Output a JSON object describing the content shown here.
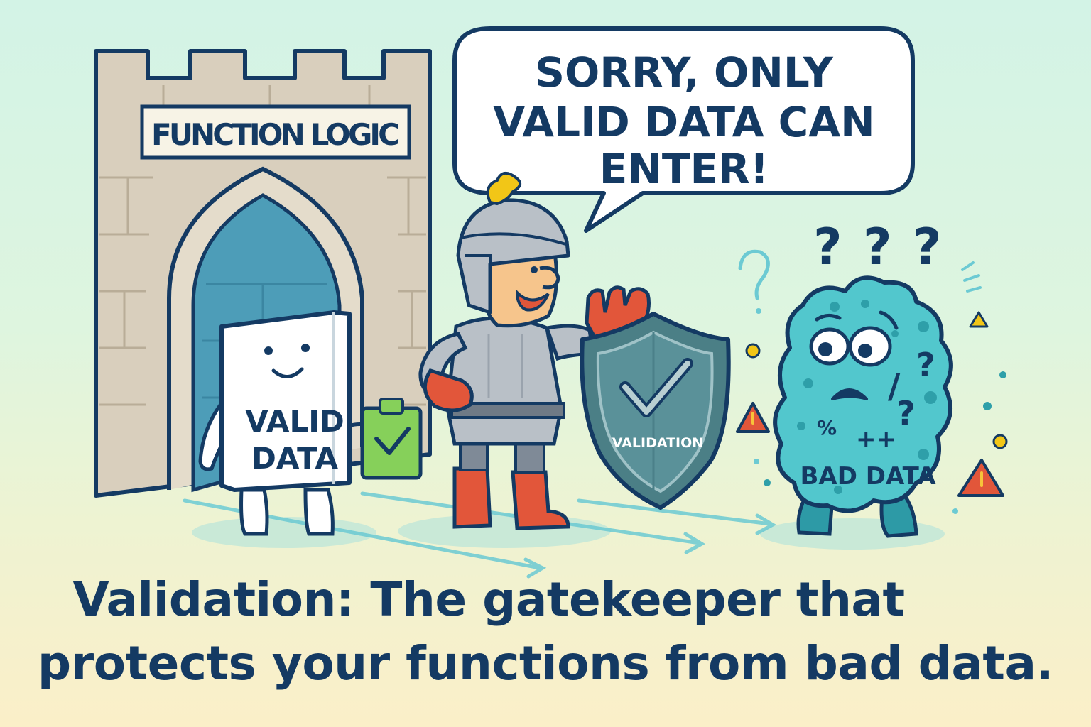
{
  "castle": {
    "sign": "FUNCTION LOGIC"
  },
  "speech_bubble": {
    "line1": "SORRY, ONLY",
    "line2": "VALID DATA CAN",
    "line3": "ENTER!"
  },
  "valid_data_character": {
    "line1": "VALID",
    "line2": "DATA"
  },
  "shield": {
    "label": "VALIDATION"
  },
  "bad_data_character": {
    "label": "BAD DATA",
    "glyphs": [
      "/",
      "%",
      "++",
      "?",
      "?"
    ],
    "question_marks": [
      "?",
      "?",
      "?"
    ]
  },
  "caption": {
    "line1": "Validation: The gatekeeper that",
    "line2": "protects your functions from bad data."
  },
  "colors": {
    "navy": "#143a63",
    "stone": "#d9cfbd",
    "door": "#4d9db8",
    "armor": "#b9c0c7",
    "red": "#e2563a",
    "blob": "#52c7cd",
    "shield": "#4b7f86",
    "green": "#86d05a"
  }
}
